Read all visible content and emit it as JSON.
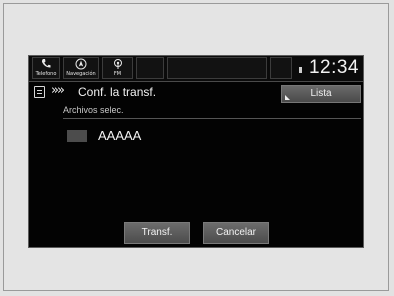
{
  "statusbar": {
    "shortcuts": [
      {
        "label": "Telefono",
        "icon": "phone-icon"
      },
      {
        "label": "Navegación",
        "icon": "navigation-icon"
      },
      {
        "label": "FM",
        "icon": "radio-icon"
      }
    ],
    "clock": "12:34"
  },
  "header": {
    "title": "Conf. la transf.",
    "list_button": "Lista"
  },
  "content": {
    "section_label": "Archivos selec.",
    "items": [
      {
        "label": "AAAAA"
      }
    ]
  },
  "actions": {
    "transfer_label": "Transf.",
    "cancel_label": "Cancelar"
  }
}
